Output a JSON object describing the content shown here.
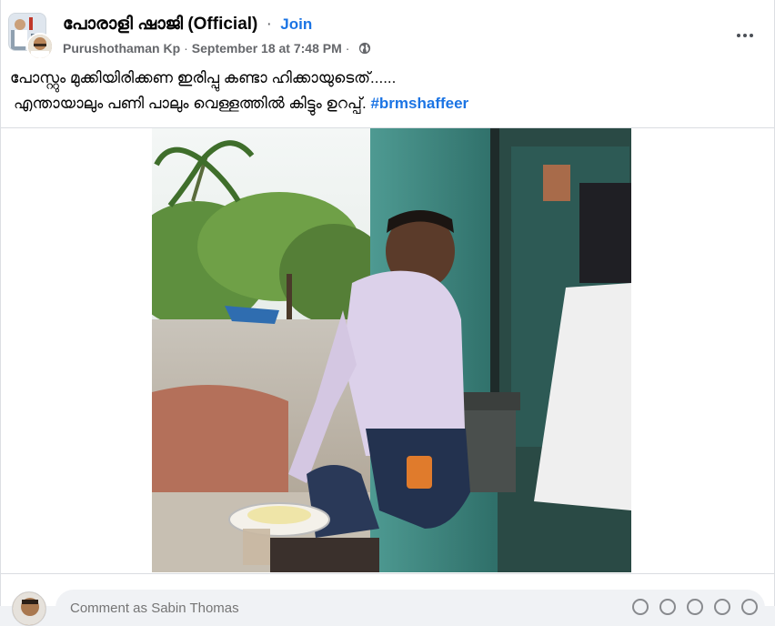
{
  "group": {
    "name": "പോരാളി ഷാജി",
    "official": "(Official)",
    "separator": "·",
    "join_label": "Join"
  },
  "post_meta": {
    "author": "Purushothaman Kp",
    "separator": "·",
    "timestamp": "September 18 at 7:48 PM",
    "separator2": "·",
    "audience_icon": "globe-icon"
  },
  "post": {
    "text_line1": "പോസ്റ്റും മുക്കിയിരിക്കണ ഇരിപ്പു കണ്ടാ ഹിക്കായുടെത്......",
    "text_line2": "എന്തായാലും പണി പാലും വെള്ളത്തിൽ കിട്ടും ഉറപ്പ്.",
    "hashtag": "#brmshaffeer"
  },
  "comment": {
    "placeholder": "Comment as Sabin Thomas"
  },
  "colors": {
    "link": "#1b74e4",
    "text_primary": "#050505",
    "text_secondary": "#65676b"
  }
}
